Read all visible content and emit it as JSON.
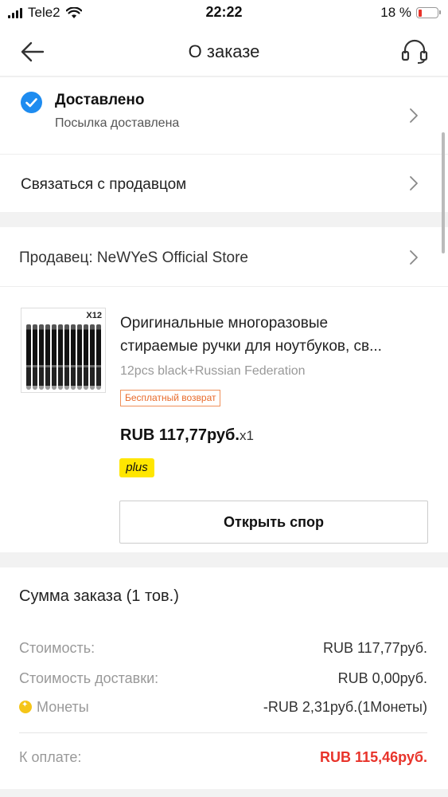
{
  "status_bar": {
    "carrier": "Tele2",
    "time": "22:22",
    "battery_percent": "18 %",
    "battery_level": 0.18
  },
  "nav": {
    "title": "О заказе",
    "back_icon": "arrow-left-icon",
    "support_icon": "headset-icon"
  },
  "delivery": {
    "status": "Доставлено",
    "subtitle": "Посылка доставлена",
    "icon": "check-circle-icon",
    "icon_color": "#1e8cf0"
  },
  "contact": {
    "label": "Связаться с продавцом"
  },
  "seller": {
    "label": "Продавец: NeWYeS Official Store"
  },
  "product": {
    "thumb_badge": "X12",
    "title_line1": "Оригинальные многоразовые",
    "title_line2": "стираемые ручки для ноутбуков, св...",
    "variant": "12pcs black+Russian Federation",
    "badge": "Бесплатный возврат",
    "price": "RUB 117,77руб.",
    "quantity": "x1",
    "plus_label": "plus",
    "dispute_button": "Открыть спор"
  },
  "summary": {
    "title": "Сумма заказа (1 тов.)",
    "rows": [
      {
        "label": "Стоимость:",
        "value": "RUB 117,77руб."
      },
      {
        "label": "Стоимость доставки:",
        "value": "RUB 0,00руб."
      },
      {
        "label": "Монеты",
        "value": "-RUB 2,31руб.(1Монеты)"
      }
    ],
    "total_label": "К оплате:",
    "total_value": "RUB 115,46руб.",
    "accent_color": "#e8332a"
  }
}
